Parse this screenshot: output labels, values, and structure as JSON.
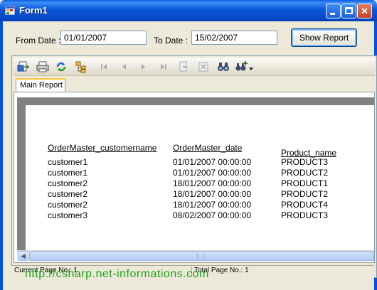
{
  "window": {
    "title": "Form1"
  },
  "form": {
    "from_label": "From Date :",
    "from_value": "01/01/2007",
    "to_label": "To Date :",
    "to_value": "15/02/2007",
    "show_button": "Show Report"
  },
  "viewer": {
    "tab_label": "Main Report",
    "toolbar_icons": [
      "export-icon",
      "print-icon",
      "refresh-icon",
      "group-tree-icon",
      "first-page-icon",
      "previous-page-icon",
      "next-page-icon",
      "last-page-icon",
      "goto-page-icon",
      "close-view-icon",
      "search-binoculars-icon",
      "zoom-icon"
    ],
    "report": {
      "headers": [
        "OrderMaster_customername",
        "OrderMaster_date",
        "Product_name"
      ],
      "rows": [
        [
          "customer1",
          "01/01/2007  00:00:00",
          "PRODUCT3"
        ],
        [
          "customer1",
          "01/01/2007  00:00:00",
          "PRODUCT2"
        ],
        [
          "customer2",
          "18/01/2007  00:00:00",
          "PRODUCT1"
        ],
        [
          "customer2",
          "18/01/2007  00:00:00",
          "PRODUCT2"
        ],
        [
          "customer2",
          "18/01/2007  00:00:00",
          "PRODUCT4"
        ],
        [
          "customer3",
          "08/02/2007  00:00:00",
          "PRODUCT3"
        ]
      ]
    },
    "status": {
      "current_page": "Current Page No.: 1",
      "total_page": "Total Page No.: 1"
    }
  },
  "watermark": "http://csharp.net-informations.com",
  "colors": {
    "titlebar": "#0a5fe0",
    "watermark": "#20a020",
    "report_bg": "#818181"
  }
}
